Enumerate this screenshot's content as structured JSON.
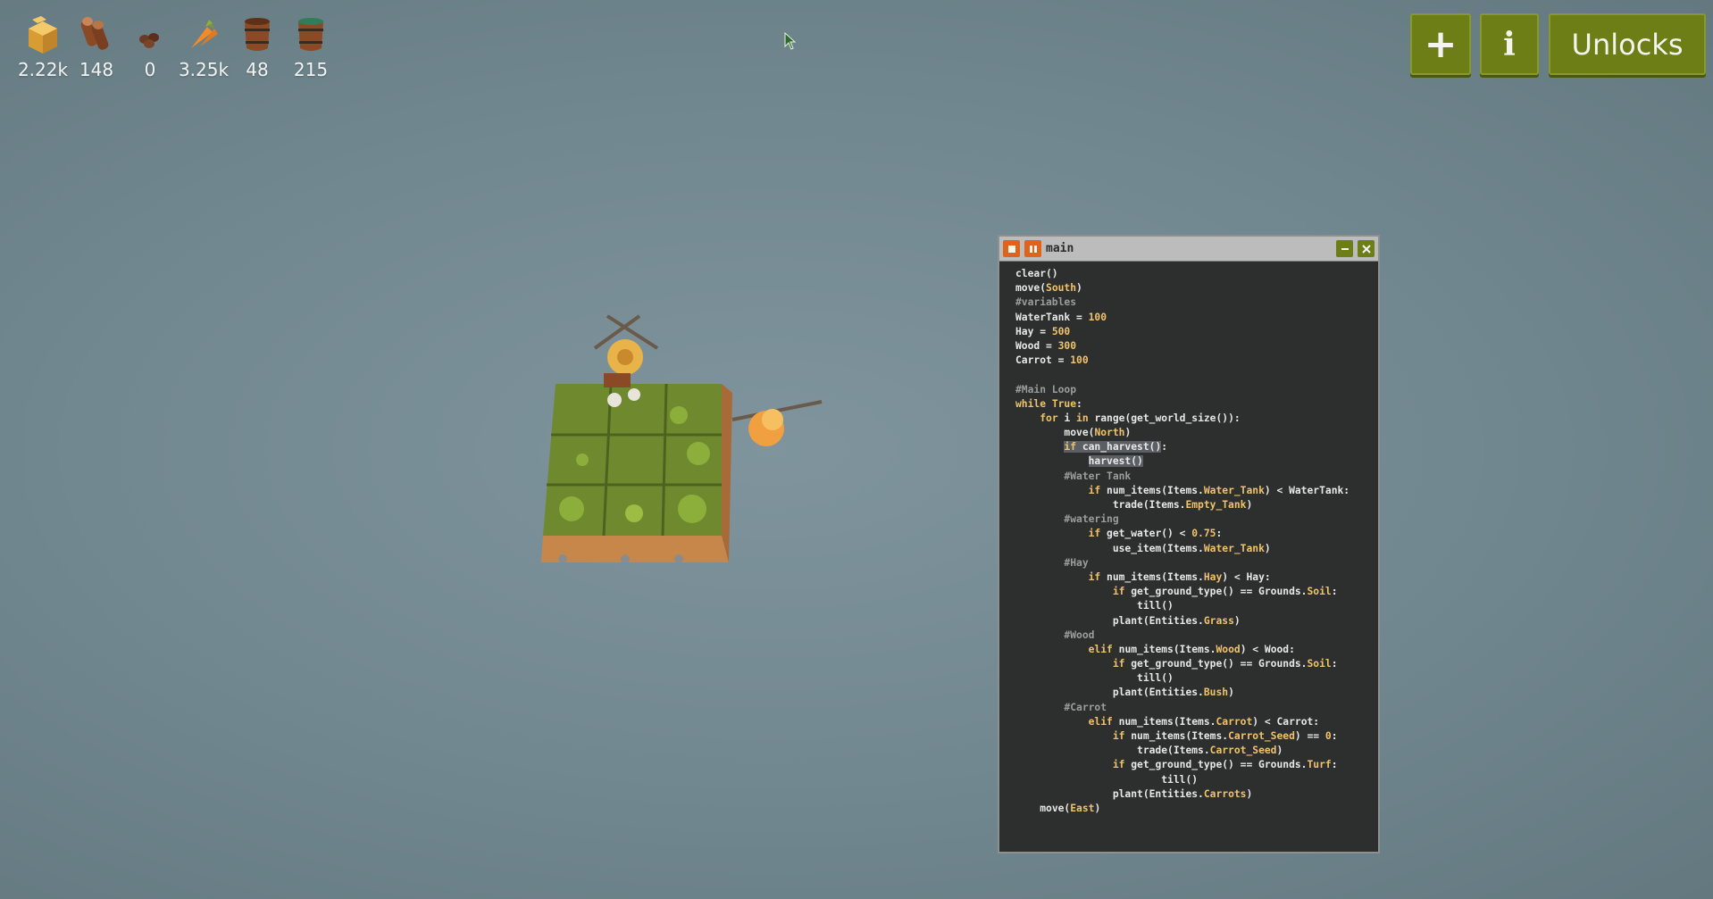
{
  "resources": [
    {
      "name": "hay-icon",
      "count": "2.22k",
      "color": "#e7b74a"
    },
    {
      "name": "wood-icon",
      "count": "148",
      "color": "#8a4a26"
    },
    {
      "name": "seeds-icon",
      "count": "0",
      "color": "#6b3a22"
    },
    {
      "name": "carrot-icon",
      "count": "3.25k",
      "color": "#f08a2a"
    },
    {
      "name": "empty-tank-icon",
      "count": "48",
      "color": "#8a4a26"
    },
    {
      "name": "water-tank-icon",
      "count": "215",
      "color": "#2e7f57"
    }
  ],
  "buttons": {
    "add": "+",
    "info": "i",
    "unlocks": "Unlocks"
  },
  "colors": {
    "button_bg": "#6d7e16",
    "editor_bg": "#2d2e2e",
    "stop_button": "#e0631a",
    "keyword": "#f0c36b"
  },
  "code_window": {
    "title": "main",
    "lines": [
      {
        "indent": 0,
        "segments": [
          {
            "t": "clear()"
          }
        ]
      },
      {
        "indent": 0,
        "segments": [
          {
            "t": "move("
          },
          {
            "t": "South",
            "c": "const"
          },
          {
            "t": ")"
          }
        ]
      },
      {
        "indent": 0,
        "segments": [
          {
            "t": "#variables",
            "c": "comment"
          }
        ]
      },
      {
        "indent": 0,
        "segments": [
          {
            "t": "WaterTank = "
          },
          {
            "t": "100",
            "c": "num"
          }
        ]
      },
      {
        "indent": 0,
        "segments": [
          {
            "t": "Hay = "
          },
          {
            "t": "500",
            "c": "num"
          }
        ]
      },
      {
        "indent": 0,
        "segments": [
          {
            "t": "Wood = "
          },
          {
            "t": "300",
            "c": "num"
          }
        ]
      },
      {
        "indent": 0,
        "segments": [
          {
            "t": "Carrot = "
          },
          {
            "t": "100",
            "c": "num"
          }
        ]
      },
      {
        "indent": 0,
        "segments": [
          {
            "t": ""
          }
        ]
      },
      {
        "indent": 0,
        "segments": [
          {
            "t": "#Main Loop",
            "c": "comment"
          }
        ]
      },
      {
        "indent": 0,
        "segments": [
          {
            "t": "while ",
            "c": "kw"
          },
          {
            "t": "True",
            "c": "kw"
          },
          {
            "t": ":"
          }
        ]
      },
      {
        "indent": 1,
        "segments": [
          {
            "t": "for ",
            "c": "kw"
          },
          {
            "t": "i "
          },
          {
            "t": "in ",
            "c": "kw"
          },
          {
            "t": "range(get_world_size()):"
          }
        ]
      },
      {
        "indent": 2,
        "segments": [
          {
            "t": "move("
          },
          {
            "t": "North",
            "c": "const"
          },
          {
            "t": ")"
          }
        ]
      },
      {
        "indent": 2,
        "segments": [
          {
            "t": "if ",
            "c": "kw hl"
          },
          {
            "t": "can_harvest(",
            "c": "hl"
          },
          {
            "t": ")",
            "c": "hl"
          },
          {
            "t": ":"
          }
        ]
      },
      {
        "indent": 3,
        "segments": [
          {
            "t": "harvest()",
            "c": "hl"
          }
        ]
      },
      {
        "indent": 2,
        "segments": [
          {
            "t": "#Water Tank",
            "c": "comment"
          }
        ]
      },
      {
        "indent": 3,
        "segments": [
          {
            "t": "if ",
            "c": "kw"
          },
          {
            "t": "num_items(Items."
          },
          {
            "t": "Water_Tank",
            "c": "const"
          },
          {
            "t": ") < WaterTank:"
          }
        ]
      },
      {
        "indent": 4,
        "segments": [
          {
            "t": "trade(Items."
          },
          {
            "t": "Empty_Tank",
            "c": "const"
          },
          {
            "t": ")"
          }
        ]
      },
      {
        "indent": 2,
        "segments": [
          {
            "t": "#watering",
            "c": "comment"
          }
        ]
      },
      {
        "indent": 3,
        "segments": [
          {
            "t": "if ",
            "c": "kw"
          },
          {
            "t": "get_water() < "
          },
          {
            "t": "0.75",
            "c": "num"
          },
          {
            "t": ":"
          }
        ]
      },
      {
        "indent": 4,
        "segments": [
          {
            "t": "use_item(Items."
          },
          {
            "t": "Water_Tank",
            "c": "const"
          },
          {
            "t": ")"
          }
        ]
      },
      {
        "indent": 2,
        "segments": [
          {
            "t": "#Hay",
            "c": "comment"
          }
        ]
      },
      {
        "indent": 3,
        "segments": [
          {
            "t": "if ",
            "c": "kw"
          },
          {
            "t": "num_items(Items."
          },
          {
            "t": "Hay",
            "c": "const"
          },
          {
            "t": ") < Hay:"
          }
        ]
      },
      {
        "indent": 4,
        "segments": [
          {
            "t": "if ",
            "c": "kw"
          },
          {
            "t": "get_ground_type() == Grounds."
          },
          {
            "t": "Soil",
            "c": "const"
          },
          {
            "t": ":"
          }
        ]
      },
      {
        "indent": 5,
        "segments": [
          {
            "t": "till()"
          }
        ]
      },
      {
        "indent": 4,
        "segments": [
          {
            "t": "plant(Entities."
          },
          {
            "t": "Grass",
            "c": "const"
          },
          {
            "t": ")"
          }
        ]
      },
      {
        "indent": 2,
        "segments": [
          {
            "t": "#Wood",
            "c": "comment"
          }
        ]
      },
      {
        "indent": 3,
        "segments": [
          {
            "t": "elif ",
            "c": "kw"
          },
          {
            "t": "num_items(Items."
          },
          {
            "t": "Wood",
            "c": "const"
          },
          {
            "t": ") < Wood:"
          }
        ]
      },
      {
        "indent": 4,
        "segments": [
          {
            "t": "if ",
            "c": "kw"
          },
          {
            "t": "get_ground_type() == Grounds."
          },
          {
            "t": "Soil",
            "c": "const"
          },
          {
            "t": ":"
          }
        ]
      },
      {
        "indent": 5,
        "segments": [
          {
            "t": "till()"
          }
        ]
      },
      {
        "indent": 4,
        "segments": [
          {
            "t": "plant(Entities."
          },
          {
            "t": "Bush",
            "c": "const"
          },
          {
            "t": ")"
          }
        ]
      },
      {
        "indent": 2,
        "segments": [
          {
            "t": "#Carrot",
            "c": "comment"
          }
        ]
      },
      {
        "indent": 3,
        "segments": [
          {
            "t": "elif ",
            "c": "kw"
          },
          {
            "t": "num_items(Items."
          },
          {
            "t": "Carrot",
            "c": "const"
          },
          {
            "t": ") < Carrot:"
          }
        ]
      },
      {
        "indent": 4,
        "segments": [
          {
            "t": "if ",
            "c": "kw"
          },
          {
            "t": "num_items(Items."
          },
          {
            "t": "Carrot_Seed",
            "c": "const"
          },
          {
            "t": ") == "
          },
          {
            "t": "0",
            "c": "num"
          },
          {
            "t": ":"
          }
        ]
      },
      {
        "indent": 5,
        "segments": [
          {
            "t": "trade(Items."
          },
          {
            "t": "Carrot_Seed",
            "c": "const"
          },
          {
            "t": ")"
          }
        ]
      },
      {
        "indent": 4,
        "segments": [
          {
            "t": "if ",
            "c": "kw"
          },
          {
            "t": "get_ground_type() == Grounds."
          },
          {
            "t": "Turf",
            "c": "const"
          },
          {
            "t": ":"
          }
        ]
      },
      {
        "indent": 6,
        "segments": [
          {
            "t": "till()"
          }
        ]
      },
      {
        "indent": 4,
        "segments": [
          {
            "t": "plant(Entities."
          },
          {
            "t": "Carrots",
            "c": "const"
          },
          {
            "t": ")"
          }
        ]
      },
      {
        "indent": 1,
        "segments": [
          {
            "t": "move("
          },
          {
            "t": "East",
            "c": "const"
          },
          {
            "t": ")"
          }
        ]
      }
    ]
  }
}
